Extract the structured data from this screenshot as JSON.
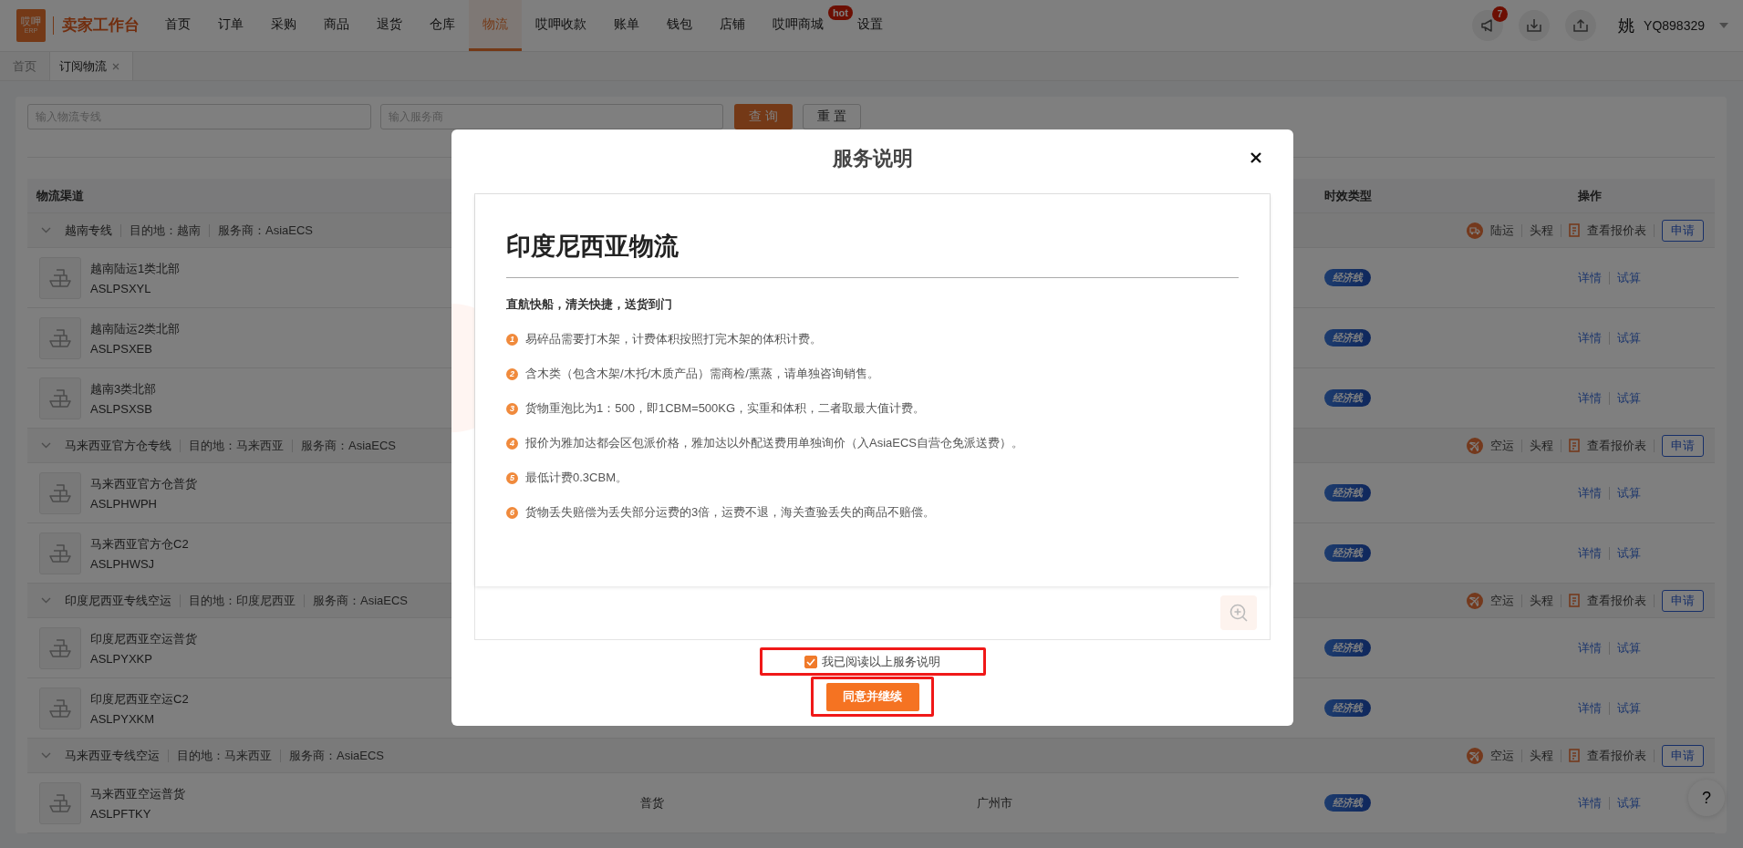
{
  "nav": {
    "logo_mark": "哎呷",
    "logo_sub": "ERP",
    "brand": "卖家工作台",
    "items": [
      {
        "label": "首页",
        "selected": false
      },
      {
        "label": "订单",
        "selected": false
      },
      {
        "label": "采购",
        "selected": false
      },
      {
        "label": "商品",
        "selected": false
      },
      {
        "label": "退货",
        "selected": false
      },
      {
        "label": "仓库",
        "selected": false
      },
      {
        "label": "物流",
        "selected": true
      },
      {
        "label": "哎呷收款",
        "selected": false
      },
      {
        "label": "账单",
        "selected": false
      },
      {
        "label": "钱包",
        "selected": false
      },
      {
        "label": "店铺",
        "selected": false
      },
      {
        "label": "哎呷商城",
        "selected": false,
        "badge": "hot"
      },
      {
        "label": "设置",
        "selected": false
      }
    ]
  },
  "user": {
    "notification_count": "7",
    "avatar": "姚",
    "username": "YQ898329"
  },
  "tabs": [
    {
      "label": "首页",
      "selected": false,
      "closable": false
    },
    {
      "label": "订阅物流",
      "selected": true,
      "closable": true
    }
  ],
  "filters": {
    "line_field": {
      "placeholder": "输入物流专线"
    },
    "provider_field": {
      "placeholder": "输入服务商"
    },
    "search_button": "查 询",
    "reset_button": "重 置"
  },
  "table": {
    "columns": {
      "channel": "物流渠道",
      "timeliness": "时效类型",
      "actions": "操作"
    },
    "groups": [
      {
        "name": "越南专线",
        "destination": "目的地：越南",
        "provider": "服务商：AsiaECS",
        "expanded": true,
        "transport": {
          "kind": "truck",
          "label": "陆运"
        },
        "leg": "头程",
        "quote_link": "查看报价表",
        "apply_button": "申请",
        "items": [
          {
            "name": "越南陆运1类北部",
            "code": "ASLPSXYL",
            "badge": "经济线",
            "links": [
              "详情",
              "试算"
            ]
          },
          {
            "name": "越南陆运2类北部",
            "code": "ASLPSXEB",
            "badge": "经济线",
            "links": [
              "详情",
              "试算"
            ]
          },
          {
            "name": "越南3类北部",
            "code": "ASLPSXSB",
            "badge": "经济线",
            "links": [
              "详情",
              "试算"
            ]
          }
        ]
      },
      {
        "name": "马来西亚官方仓专线",
        "destination": "目的地：马来西亚",
        "provider": "服务商：AsiaECS",
        "expanded": true,
        "transport": {
          "kind": "plane",
          "label": "空运"
        },
        "leg": "头程",
        "quote_link": "查看报价表",
        "apply_button": "申请",
        "items": [
          {
            "name": "马来西亚官方仓普货",
            "code": "ASLPHWPH",
            "badge": "经济线",
            "links": [
              "详情",
              "试算"
            ]
          },
          {
            "name": "马来西亚官方仓C2",
            "code": "ASLPHWSJ",
            "badge": "经济线",
            "links": [
              "详情",
              "试算"
            ]
          }
        ]
      },
      {
        "name": "印度尼西亚专线空运",
        "destination": "目的地：印度尼西亚",
        "provider": "服务商：AsiaECS",
        "expanded": true,
        "transport": {
          "kind": "plane",
          "label": "空运"
        },
        "leg": "头程",
        "quote_link": "查看报价表",
        "apply_button": "申请",
        "items": [
          {
            "name": "印度尼西亚空运普货",
            "code": "ASLPYXKP",
            "badge": "经济线",
            "links": [
              "详情",
              "试算"
            ]
          },
          {
            "name": "印度尼西亚空运C2",
            "code": "ASLPYXKM",
            "badge": "经济线",
            "links": [
              "详情",
              "试算"
            ]
          }
        ]
      },
      {
        "name": "马来西亚专线空运",
        "destination": "目的地：马来西亚",
        "provider": "服务商：AsiaECS",
        "expanded": true,
        "transport": {
          "kind": "plane",
          "label": "空运"
        },
        "leg": "头程",
        "quote_link": "查看报价表",
        "apply_button": "申请",
        "items": [
          {
            "name": "马来西亚空运普货",
            "code": "ASLPFTKY",
            "category": "普货",
            "origin": "广州市",
            "badge": "经济线",
            "links": [
              "详情",
              "试算"
            ]
          }
        ]
      }
    ]
  },
  "help_button": "?",
  "dialog": {
    "title": "服务说明",
    "document": {
      "heading": "印度尼西亚物流",
      "tagline": "直航快船，清关快捷，送货到门",
      "points": [
        {
          "number": "1",
          "text": "易碎品需要打木架，计费体积按照打完木架的体积计费。"
        },
        {
          "number": "2",
          "text": "含木类（包含木架/木托/木质产品）需商检/熏蒸，请单独咨询销售。"
        },
        {
          "number": "3",
          "text": "货物重泡比为1：500，即1CBM=500KG，实重和体积，二者取最大值计费。"
        },
        {
          "number": "4",
          "text": "报价为雅加达都会区包派价格，雅加达以外配送费用单独询价（入AsiaECS自营仓免派送费）。"
        },
        {
          "number": "5",
          "text": "最低计费0.3CBM。"
        },
        {
          "number": "6",
          "text": "货物丢失赔偿为丢失部分运费的3倍，运费不退，海关查验丢失的商品不赔偿。"
        }
      ]
    },
    "agreement": {
      "label": "我已阅读以上服务说明",
      "checked": true,
      "highlighted": true
    },
    "confirm_button": {
      "label": "同意并继续",
      "highlighted": true
    }
  }
}
